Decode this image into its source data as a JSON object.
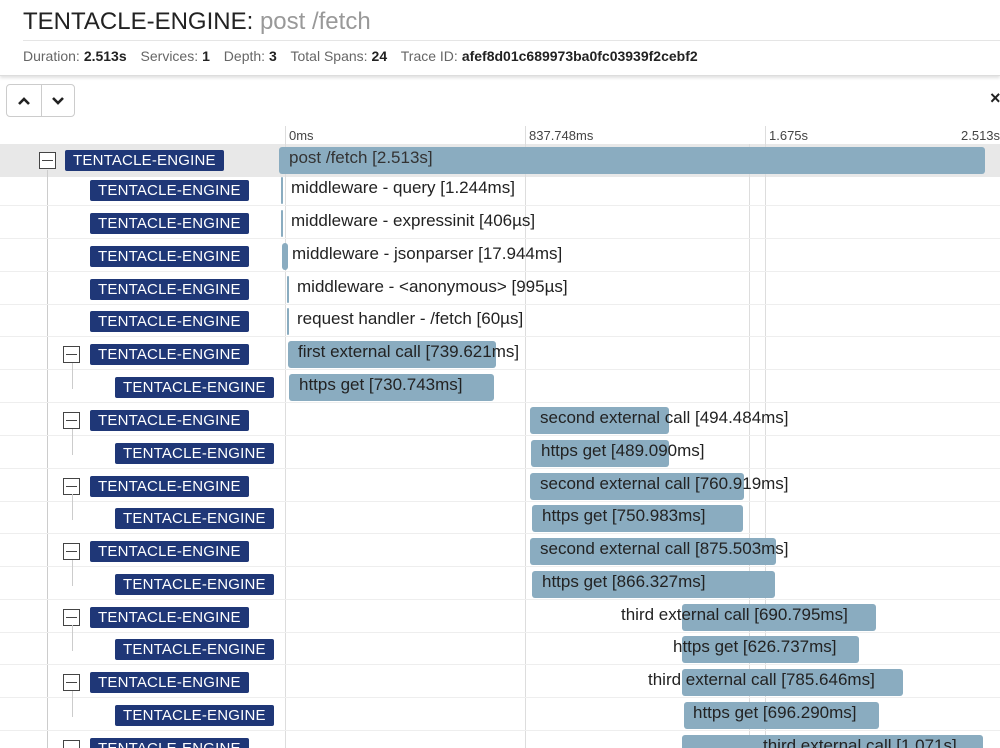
{
  "trace": {
    "service": "TENTACLE-ENGINE",
    "operation": "post /fetch",
    "title_sep": ": ",
    "meta": [
      {
        "key": "Duration:",
        "value": "2.513s"
      },
      {
        "key": "Services:",
        "value": "1"
      },
      {
        "key": "Depth:",
        "value": "3"
      },
      {
        "key": "Total Spans:",
        "value": "24"
      },
      {
        "key": "Trace ID:",
        "value": "afef8d01c689973ba0fc03939f2cebf2"
      }
    ]
  },
  "toolbar": {
    "up_icon": "chevron-up-icon",
    "down_icon": "chevron-down-icon",
    "close_label": "×"
  },
  "timeline": {
    "ticks": [
      "0ms",
      "837.748ms",
      "1.675s",
      "2.513s"
    ]
  },
  "colors": {
    "badge": "#1f3777",
    "bar": "#8aacc0",
    "highlight_row": "#e8e8e8"
  },
  "spans": [
    {
      "service": "TENTACLE-ENGINE",
      "label": "post /fetch [2.513s]",
      "depth": 0,
      "expandable": true
    },
    {
      "service": "TENTACLE-ENGINE",
      "label": "middleware - query [1.244ms]",
      "depth": 1,
      "expandable": false
    },
    {
      "service": "TENTACLE-ENGINE",
      "label": "middleware - expressinit [406µs]",
      "depth": 1,
      "expandable": false
    },
    {
      "service": "TENTACLE-ENGINE",
      "label": "middleware - jsonparser [17.944ms]",
      "depth": 1,
      "expandable": false
    },
    {
      "service": "TENTACLE-ENGINE",
      "label": "middleware - <anonymous> [995µs]",
      "depth": 1,
      "expandable": false
    },
    {
      "service": "TENTACLE-ENGINE",
      "label": "request handler - /fetch [60µs]",
      "depth": 1,
      "expandable": false
    },
    {
      "service": "TENTACLE-ENGINE",
      "label": "first external call [739.621ms]",
      "depth": 1,
      "expandable": true
    },
    {
      "service": "TENTACLE-ENGINE",
      "label": "https get [730.743ms]",
      "depth": 2,
      "expandable": false
    },
    {
      "service": "TENTACLE-ENGINE",
      "label": "second external call [494.484ms]",
      "depth": 1,
      "expandable": true
    },
    {
      "service": "TENTACLE-ENGINE",
      "label": "https get [489.090ms]",
      "depth": 2,
      "expandable": false
    },
    {
      "service": "TENTACLE-ENGINE",
      "label": "second external call [760.919ms]",
      "depth": 1,
      "expandable": true
    },
    {
      "service": "TENTACLE-ENGINE",
      "label": "https get [750.983ms]",
      "depth": 2,
      "expandable": false
    },
    {
      "service": "TENTACLE-ENGINE",
      "label": "second external call [875.503ms]",
      "depth": 1,
      "expandable": true
    },
    {
      "service": "TENTACLE-ENGINE",
      "label": "https get [866.327ms]",
      "depth": 2,
      "expandable": false
    },
    {
      "service": "TENTACLE-ENGINE",
      "label": "third external call [690.795ms]",
      "depth": 1,
      "expandable": true
    },
    {
      "service": "TENTACLE-ENGINE",
      "label": "https get [626.737ms]",
      "depth": 2,
      "expandable": false
    },
    {
      "service": "TENTACLE-ENGINE",
      "label": "third external call [785.646ms]",
      "depth": 1,
      "expandable": true
    },
    {
      "service": "TENTACLE-ENGINE",
      "label": "https get [696.290ms]",
      "depth": 2,
      "expandable": false
    },
    {
      "service": "TENTACLE-ENGINE",
      "label": "third external call [1.071s]",
      "depth": 1,
      "expandable": true
    }
  ]
}
